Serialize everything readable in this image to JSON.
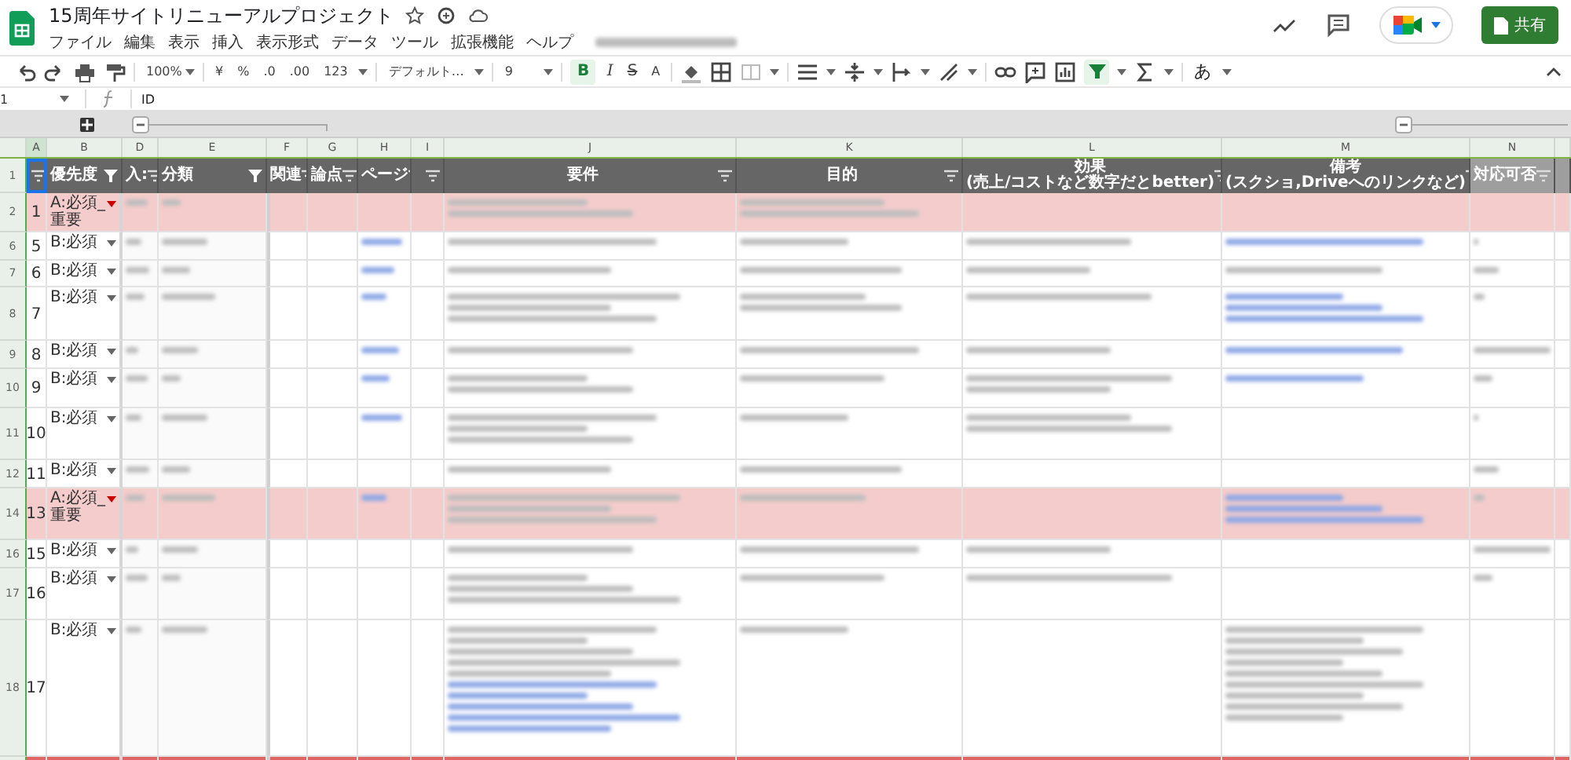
{
  "app": {
    "title": "15周年サイトリニューアルプロジェクト",
    "starred": false,
    "menu": [
      "ファイル",
      "編集",
      "表示",
      "挿入",
      "表示形式",
      "データ",
      "ツール",
      "拡張機能",
      "ヘルプ"
    ],
    "share_button": "共有"
  },
  "toolbar": {
    "zoom": "100%",
    "currency": "¥",
    "percent": "%",
    "decrease_decimals": ".0",
    "increase_decimals": ".00",
    "number_format": "123",
    "font": "デフォルト…",
    "font_size": "9",
    "bold": {
      "label": "B",
      "active": true
    },
    "italic": "I",
    "strikethrough": "S",
    "text_color": "A",
    "filter_active": true,
    "input_tools": "あ"
  },
  "formula_bar": {
    "cell": "1",
    "value": "ID"
  },
  "header_row_number": "1",
  "columns": [
    {
      "letter": "A",
      "filtered": false,
      "selected": true,
      "dimmed": false
    },
    {
      "letter": "B",
      "header": "優先度",
      "filtered": true,
      "selected": false,
      "dimmed": false
    },
    {
      "letter": "D",
      "header": "入:",
      "filtered": false,
      "selected": false,
      "dimmed": false
    },
    {
      "letter": "E",
      "header": "分類",
      "filtered": true,
      "selected": false,
      "dimmed": false
    },
    {
      "letter": "F",
      "header": "関連",
      "filtered": false,
      "selected": false,
      "dimmed": false
    },
    {
      "letter": "G",
      "header": "論点",
      "filtered": false,
      "selected": false,
      "dimmed": false
    },
    {
      "letter": "H",
      "header": "ページ",
      "filtered": false,
      "selected": false,
      "dimmed": false
    },
    {
      "letter": "I",
      "filtered": false,
      "selected": false,
      "dimmed": false
    },
    {
      "letter": "J",
      "header": "要件",
      "filtered": false,
      "selected": false,
      "dimmed": false
    },
    {
      "letter": "K",
      "header": "目的",
      "filtered": false,
      "selected": false,
      "dimmed": false
    },
    {
      "letter": "L",
      "header": "効果\n(売上/コストなど数字だとbetter)",
      "filtered": false,
      "selected": false,
      "dimmed": false
    },
    {
      "letter": "M",
      "header": "備考\n(スクショ,Driveへのリンクなど)",
      "filtered": false,
      "selected": false,
      "dimmed": false
    },
    {
      "letter": "N",
      "header": "対応可否",
      "filtered": false,
      "selected": false,
      "dimmed": true
    }
  ],
  "rows": [
    {
      "row": "2",
      "id": "1",
      "priority": "A:必須_重要",
      "kind": "A"
    },
    {
      "row": "6",
      "id": "5",
      "priority": "B:必須",
      "kind": "B"
    },
    {
      "row": "7",
      "id": "6",
      "priority": "B:必須",
      "kind": "B"
    },
    {
      "row": "8",
      "id": "7",
      "priority": "B:必須",
      "kind": "B"
    },
    {
      "row": "9",
      "id": "8",
      "priority": "B:必須",
      "kind": "B"
    },
    {
      "row": "10",
      "id": "9",
      "priority": "B:必須",
      "kind": "B"
    },
    {
      "row": "11",
      "id": "10",
      "priority": "B:必須",
      "kind": "B"
    },
    {
      "row": "12",
      "id": "11",
      "priority": "B:必須",
      "kind": "B"
    },
    {
      "row": "14",
      "id": "13",
      "priority": "A:必須_重要",
      "kind": "A"
    },
    {
      "row": "16",
      "id": "15",
      "priority": "B:必須",
      "kind": "B"
    },
    {
      "row": "17",
      "id": "16",
      "priority": "B:必須",
      "kind": "B"
    },
    {
      "row": "18",
      "id": "17",
      "priority": "B:必須",
      "kind": "B"
    },
    {
      "kind": "S"
    }
  ]
}
